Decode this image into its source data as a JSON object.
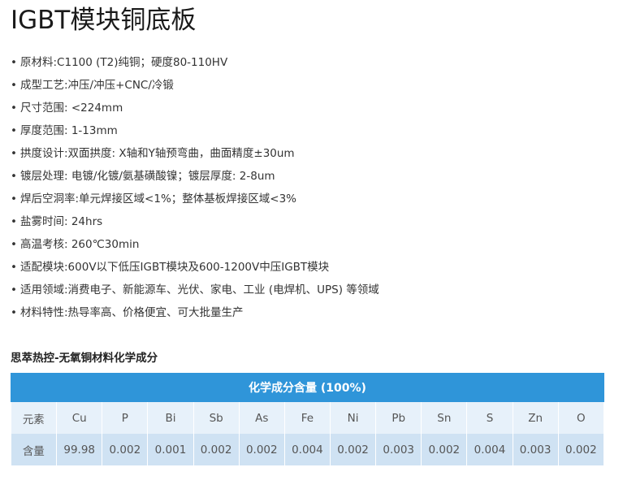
{
  "title": "IGBT模块铜底板",
  "specs": [
    "原材料:C1100 (T2)纯铜；硬度80-110HV",
    "成型工艺:冲压/冲压+CNC/冷锻",
    "尺寸范围: <224mm",
    "厚度范围: 1-13mm",
    "拱度设计:双面拱度: X轴和Y轴预弯曲，曲面精度±30um",
    "镀层处理: 电镀/化镀/氨基磺酸镍；镀层厚度: 2-8um",
    "焊后空洞率:单元焊接区域<1%；整体基板焊接区域<3%",
    "盐雾时间: 24hrs",
    "高温考核: 260℃30min",
    "适配模块:600V以下低压IGBT模块及600-1200V中压IGBT模块",
    "适用领域:消费电子、新能源车、光伏、家电、工业 (电焊机、UPS) 等领域",
    "材料特性:热导率高、价格便宜、可大批量生产"
  ],
  "bullet": "•",
  "section_title": "思萃热控-无氧铜材料化学成分",
  "table": {
    "header": "化学成分含量 (100%)",
    "row1_label": "元素",
    "row2_label": "含量",
    "elements": [
      "Cu",
      "P",
      "Bi",
      "Sb",
      "As",
      "Fe",
      "Ni",
      "Pb",
      "Sn",
      "S",
      "Zn",
      "O"
    ],
    "contents": [
      "99.98",
      "0.002",
      "0.001",
      "0.002",
      "0.002",
      "0.004",
      "0.002",
      "0.003",
      "0.002",
      "0.004",
      "0.003",
      "0.002"
    ]
  },
  "colors": {
    "header_bg": "#2f95d9",
    "row1_bg": "#e7f1fa",
    "row2_bg": "#cfe2f3"
  }
}
